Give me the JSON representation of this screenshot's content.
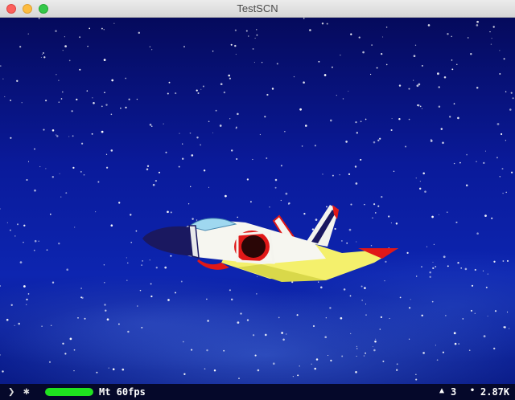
{
  "window": {
    "title": "TestSCN",
    "close_icon": "close-icon",
    "minimize_icon": "minimize-icon",
    "maximize_icon": "zoom-icon"
  },
  "scene": {
    "background": "starfield",
    "object": "jet-fighter",
    "colors": {
      "sky": "#0a1a9a",
      "star": "#ffffff",
      "fuselage": "#f6f6f0",
      "wing": "#f4f06c",
      "accent": "#e01818",
      "nose": "#1a1860"
    }
  },
  "stats": {
    "expand_icon": "chevron-right-icon",
    "settings_icon": "gear-icon",
    "fps_fraction": 1.0,
    "fps_text": "Mt 60fps",
    "triangles_icon": "triangle-icon",
    "triangles_value": "3",
    "points_icon": "point-icon",
    "points_value": "2.87K",
    "colors": {
      "fps_bar": "#1fe21f",
      "bar_bg": "#05082a"
    }
  }
}
